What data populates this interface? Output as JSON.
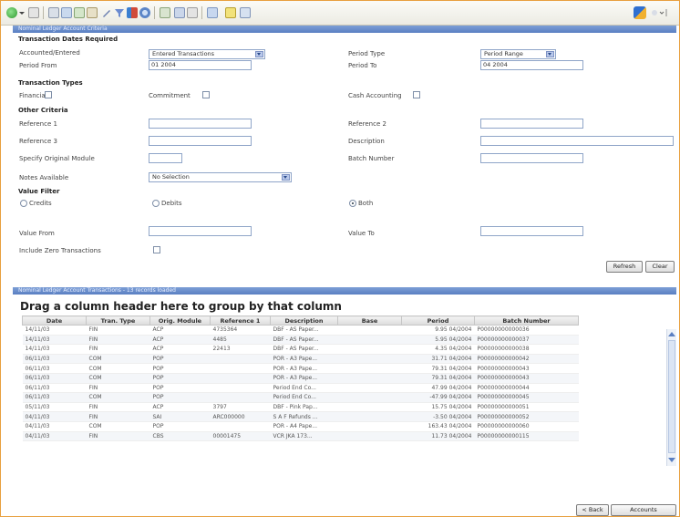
{
  "header": {
    "title": "Nominal Ledger Account Criteria"
  },
  "sections": {
    "transaction_dates": "Transaction Dates Required",
    "transaction_types": "Transaction Types",
    "other_criteria": "Other Criteria",
    "value_filter": "Value Filter"
  },
  "dates": {
    "dates_label": "Accounted/Entered",
    "dates_value": "Entered Transactions",
    "period_type_label": "Period Type",
    "period_type_value": "Period Range",
    "period_from_label": "Period From",
    "period_from_value": "01 2004",
    "period_to_label": "Period To",
    "period_to_value": "04 2004"
  },
  "types": {
    "financial": "Financial",
    "commitment": "Commitment",
    "cash_accounting": "Cash Accounting"
  },
  "other": {
    "reference1": "Reference 1",
    "reference2": "Reference 2",
    "reference3": "Reference 3",
    "description": "Description",
    "specify_module": "Specify Original Module",
    "batch_number": "Batch Number",
    "notes_available": "Notes Available",
    "notes_value": "No Selection"
  },
  "value_filter": {
    "credits": "Credits",
    "debits": "Debits",
    "both": "Both",
    "value_from": "Value From",
    "value_to": "Value To",
    "include_zero": "Include Zero Transactions"
  },
  "buttons": {
    "refresh": "Refresh",
    "clear": "Clear",
    "back": "< Back",
    "accounts": "Accounts"
  },
  "results": {
    "title": "Nominal Ledger Account Transactions - 13 records loaded",
    "group_hint": "Drag a column header here to group by that column",
    "columns": [
      "Date",
      "Tran. Type",
      "Orig. Module",
      "Reference 1",
      "Description",
      "Base",
      "Period",
      "Batch Number"
    ],
    "rows": [
      [
        "14/11/03",
        "FIN",
        "ACP",
        "4735364",
        "DBF - AS Paper...",
        "9.95 04/2004",
        "P00000000000036"
      ],
      [
        "14/11/03",
        "FIN",
        "ACP",
        "4485",
        "DBF - AS Paper...",
        "5.95 04/2004",
        "P00000000000037"
      ],
      [
        "14/11/03",
        "FIN",
        "ACP",
        "22413",
        "DBF - AS Paper...",
        "4.35 04/2004",
        "P00000000000038"
      ],
      [
        "06/11/03",
        "COM",
        "POP",
        "",
        "POR - A3 Pape...",
        "31.71 04/2004",
        "P00000000000042"
      ],
      [
        "06/11/03",
        "COM",
        "POP",
        "",
        "POR - A3 Pape...",
        "79.31 04/2004",
        "P00000000000043"
      ],
      [
        "06/11/03",
        "COM",
        "POP",
        "",
        "POR - A3 Pape...",
        "79.31 04/2004",
        "P00000000000043"
      ],
      [
        "06/11/03",
        "FIN",
        "POP",
        "",
        "Period End Co...",
        "47.99 04/2004",
        "P00000000000044"
      ],
      [
        "06/11/03",
        "COM",
        "POP",
        "",
        "Period End Co...",
        "-47.99 04/2004",
        "P00000000000045"
      ],
      [
        "05/11/03",
        "FIN",
        "ACP",
        "3797",
        "DBF - Pink Pap...",
        "15.75 04/2004",
        "P00000000000051"
      ],
      [
        "04/11/03",
        "FIN",
        "SAI",
        "ARC000000",
        "S A F Refunds ...",
        "-3.50 04/2004",
        "P00000000000052"
      ],
      [
        "04/11/03",
        "COM",
        "POP",
        "",
        "POR - A4 Pape...",
        "163.43 04/2004",
        "P00000000000060"
      ],
      [
        "04/11/03",
        "FIN",
        "CBS",
        "00001475",
        "VCR JKA 173...",
        "11.73 04/2004",
        "P00000000000115"
      ]
    ]
  },
  "colors": {
    "accent": "#5a7fc2",
    "frame": "#e8a040"
  },
  "icons": [
    "back-icon",
    "forward-icon",
    "home-icon",
    "toolbar-icon",
    "help-icon"
  ]
}
